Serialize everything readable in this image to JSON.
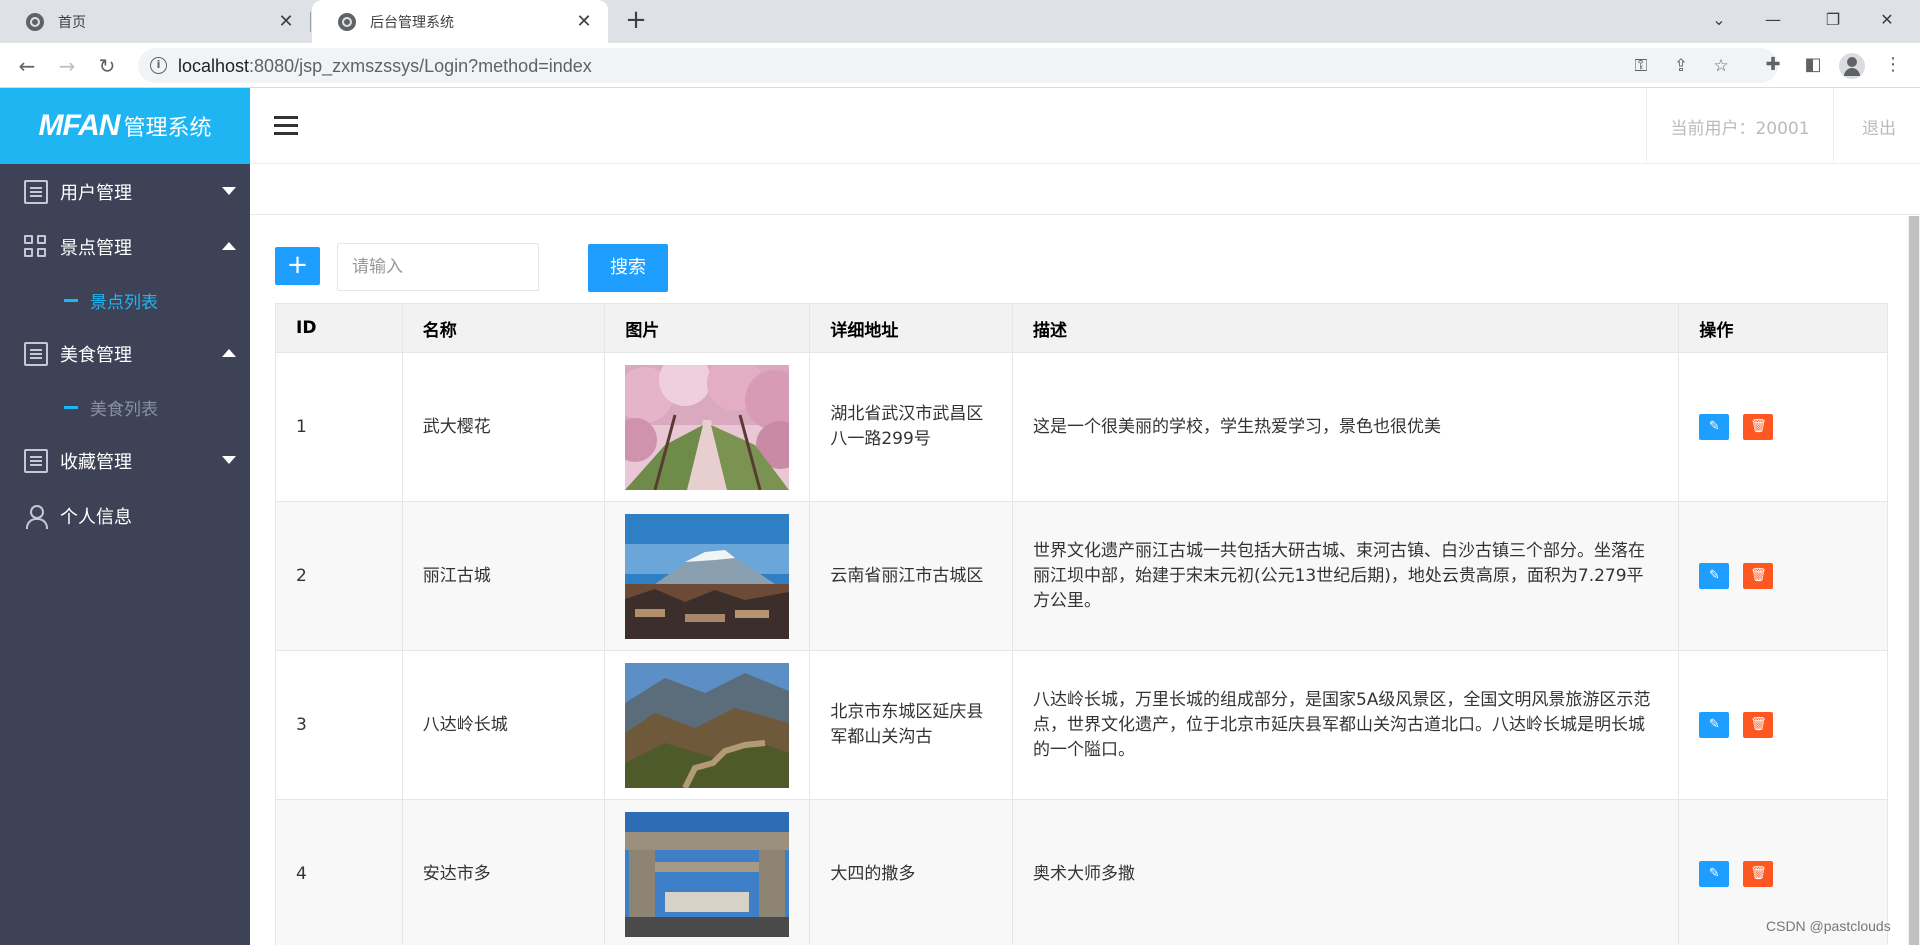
{
  "browser": {
    "tabs": [
      {
        "title": "首页",
        "active": false
      },
      {
        "title": "后台管理系统",
        "active": true
      }
    ],
    "url_host": "localhost",
    "url_rest": ":8080/jsp_zxmszssys/Login?method=index"
  },
  "sidebar": {
    "logo_brand": "MFAN",
    "logo_suffix": "管理系统",
    "menu": [
      {
        "label": "用户管理",
        "icon": "list-icon",
        "expanded": false
      },
      {
        "label": "景点管理",
        "icon": "grid-icon",
        "expanded": true,
        "sub": [
          {
            "label": "景点列表",
            "active": true
          }
        ]
      },
      {
        "label": "美食管理",
        "icon": "list-icon",
        "expanded": true,
        "sub": [
          {
            "label": "美食列表",
            "active": false
          }
        ]
      },
      {
        "label": "收藏管理",
        "icon": "list-icon",
        "expanded": false
      },
      {
        "label": "个人信息",
        "icon": "user-icon"
      }
    ]
  },
  "header": {
    "current_user": "当前用户：20001",
    "logout": "退出"
  },
  "toolbar": {
    "add_label": "+",
    "search_placeholder": "请输入",
    "search_label": "搜索"
  },
  "table": {
    "columns": [
      "ID",
      "名称",
      "图片",
      "详细地址",
      "描述",
      "操作"
    ],
    "rows": [
      {
        "id": "1",
        "name": "武大樱花",
        "image": "cherry-blossom-path",
        "address": "湖北省武汉市武昌区八一路299号",
        "desc": "这是一个很美丽的学校，学生热爱学习，景色也很优美"
      },
      {
        "id": "2",
        "name": "丽江古城",
        "image": "lijiang-old-town",
        "address": "云南省丽江市古城区",
        "desc": "世界文化遗产丽江古城一共包括大研古城、束河古镇、白沙古镇三个部分。坐落在丽江坝中部，始建于宋末元初(公元13世纪后期)，地处云贵高原，面积为7.279平方公里。"
      },
      {
        "id": "3",
        "name": "八达岭长城",
        "image": "great-wall",
        "address": "北京市东城区延庆县军都山关沟古",
        "desc": "八达岭长城，万里长城的组成部分，是国家5A级风景区，全国文明风景旅游区示范点，世界文化遗产，位于北京市延庆县军都山关沟古道北口。八达岭长城是明长城的一个隘口。"
      },
      {
        "id": "4",
        "name": "安达市多",
        "image": "stone-gate-square",
        "address": "大四的撒多",
        "desc": "奥术大师多撒"
      }
    ]
  },
  "watermark": "CSDN @pastclouds",
  "colors": {
    "accent": "#1fb5f2",
    "primary_button": "#1e9fff",
    "danger_button": "#ff5722",
    "sidebar_bg": "#3d4257"
  }
}
